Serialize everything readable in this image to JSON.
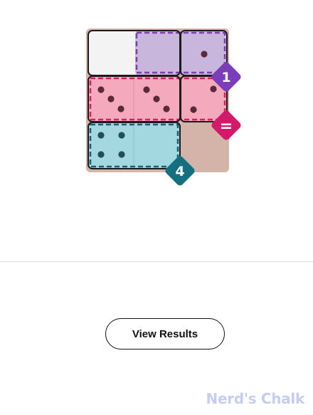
{
  "board": {
    "colors": {
      "frame": "#d4b3a8",
      "empty_tile": "#f3f3f3",
      "purple_region": "#c8b6dc",
      "purple_dashes": "#7c3fb2",
      "pink_region": "#f4a9bd",
      "pink_dashes": "#d4215f",
      "teal_region": "#a3d8e0",
      "teal_dashes": "#1a5f6f",
      "pip": "#5a2a3a",
      "pip_teal": "#1f4e5c"
    },
    "regions": [
      {
        "id": "purple",
        "condition": "1",
        "badge_color": "#7b3db8"
      },
      {
        "id": "pink",
        "condition": "=",
        "badge_color": "#d3196a"
      },
      {
        "id": "teal",
        "condition": "4",
        "badge_color": "#146f80"
      }
    ],
    "dominoes": [
      {
        "id": "top",
        "halves": [
          0,
          0
        ]
      },
      {
        "id": "top-right",
        "halves": [
          1
        ]
      },
      {
        "id": "middle-left",
        "halves": [
          3,
          3
        ]
      },
      {
        "id": "middle-right",
        "halves": [
          2
        ]
      },
      {
        "id": "bottom",
        "halves": [
          4,
          0
        ]
      }
    ]
  },
  "actions": {
    "view_results": "View Results"
  },
  "watermark": "Nerd's Chalk"
}
